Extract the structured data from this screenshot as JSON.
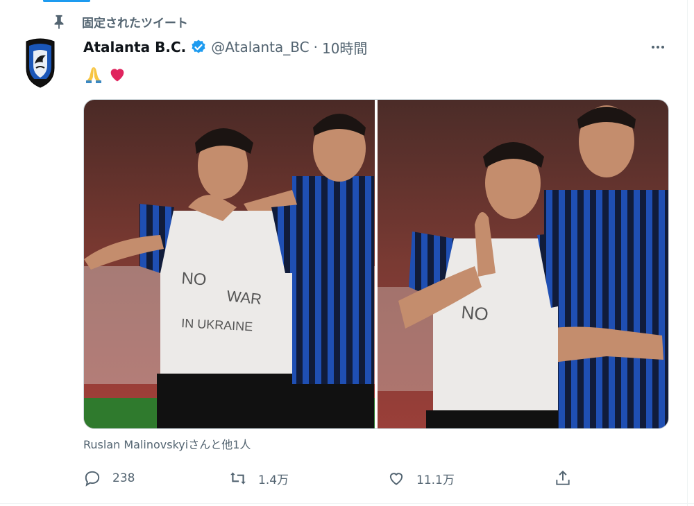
{
  "pinned_label": "固定されたツイート",
  "tweet": {
    "display_name": "Atalanta B.C.",
    "handle": "@Atalanta_BC",
    "separator": "·",
    "time": "10時間",
    "text_emojis": [
      "🙏",
      "❤"
    ],
    "tagged": "Ruslan Malinovskyiさんと他1人",
    "photo1": {
      "shirt_lines": [
        "NO",
        "WAR",
        "IN UKRAINE"
      ]
    },
    "photo2": {
      "shirt_lines": [
        "NO"
      ]
    }
  },
  "actions": {
    "reply_count": "238",
    "retweet_count": "1.4万",
    "like_count": "11.1万"
  },
  "colors": {
    "accent": "#1d9bf0",
    "secondary_text": "#536471",
    "like_red": "#f91880"
  }
}
